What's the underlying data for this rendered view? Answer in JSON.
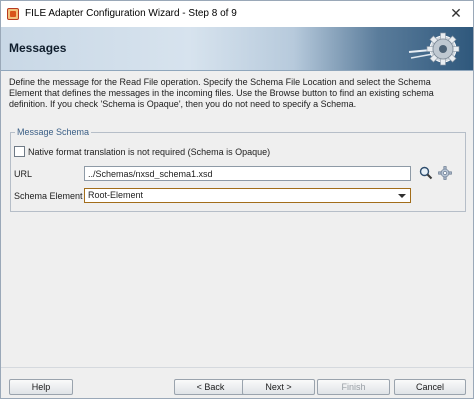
{
  "window": {
    "title": "FILE Adapter Configuration Wizard - Step 8 of 9",
    "close_glyph": "✕"
  },
  "header": {
    "title": "Messages",
    "graphic_icon": "wizard-gear-icon"
  },
  "description": "Define the message for the Read File operation.  Specify the Schema File Location and select the Schema Element that defines the messages in the incoming files. Use the Browse button to find an existing schema definition. If you check 'Schema is Opaque', then you do not need to specify a Schema.",
  "schema_group": {
    "legend": "Message Schema",
    "native_format_checkbox": {
      "label": "Native format translation is not required (Schema is Opaque)",
      "checked": false
    },
    "url": {
      "label": "URL",
      "value": "../Schemas/nxsd_schema1.xsd",
      "search_icon": "search-icon",
      "browse_icon": "gear-icon"
    },
    "schema_element": {
      "label": "Schema Element",
      "selected": "Root-Element"
    }
  },
  "buttons": {
    "help": "Help",
    "back": "< Back",
    "next": "Next >",
    "finish": "Finish",
    "cancel": "Cancel"
  }
}
